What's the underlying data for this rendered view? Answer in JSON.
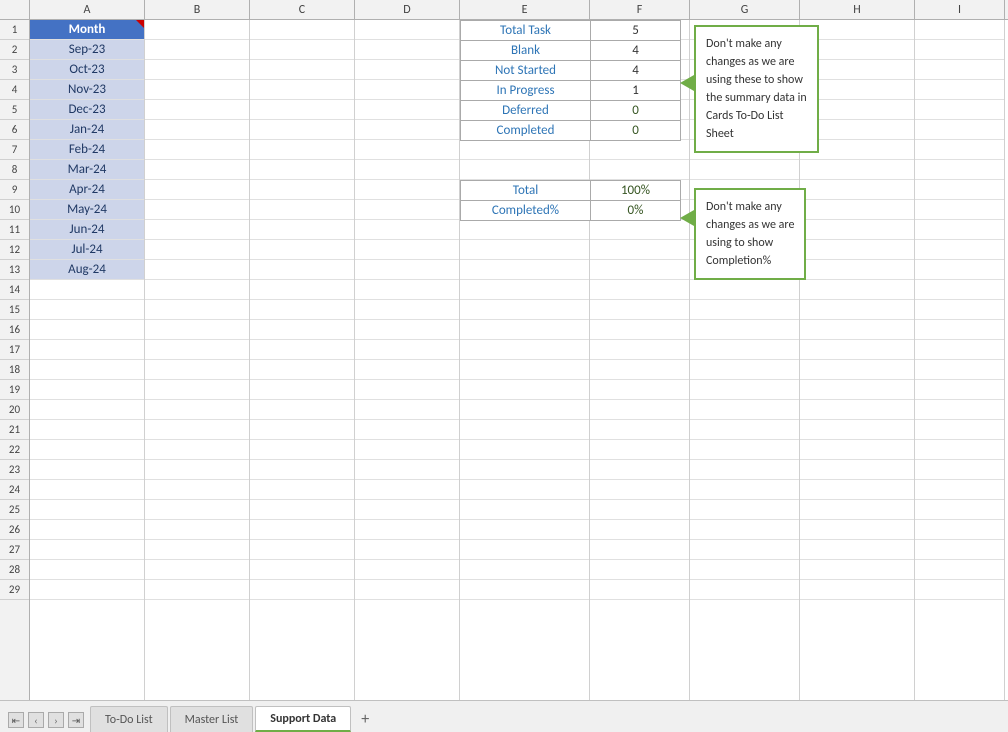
{
  "columns": [
    "A",
    "B",
    "C",
    "D",
    "E",
    "F",
    "G",
    "H",
    "I"
  ],
  "rows": 29,
  "col_a_header": "Month",
  "col_a_data": [
    "Sep-23",
    "Oct-23",
    "Nov-23",
    "Dec-23",
    "Jan-24",
    "Feb-24",
    "Mar-24",
    "Apr-24",
    "May-24",
    "Jun-24",
    "Jul-24",
    "Aug-24"
  ],
  "summary_table1": {
    "rows": [
      {
        "label": "Total Task",
        "value": "5"
      },
      {
        "label": "Blank",
        "value": "4"
      },
      {
        "label": "Not Started",
        "value": "4"
      },
      {
        "label": "In Progress",
        "value": "1"
      },
      {
        "label": "Deferred",
        "value": "0"
      },
      {
        "label": "Completed",
        "value": "0"
      }
    ]
  },
  "summary_table2": {
    "rows": [
      {
        "label": "Total",
        "value": "100%"
      },
      {
        "label": "Completed%",
        "value": "0%"
      }
    ]
  },
  "comment1": "Don't make any\nchanges as we are\nusing these to show\nthe summary data in\nCards To-Do List\nSheet",
  "comment2": "Don't make any\nchanges as we are\nusing to show\nCompletion%",
  "tabs": [
    "To-Do List",
    "Master List",
    "Support Data"
  ],
  "active_tab": "Support Data",
  "tab_add": "+"
}
